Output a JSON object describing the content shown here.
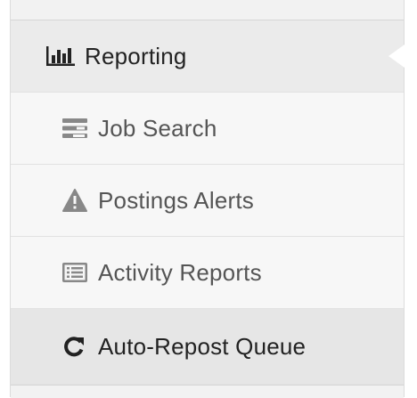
{
  "nav": {
    "parent": {
      "label": "Reporting",
      "icon": "bar-chart-icon"
    },
    "children": [
      {
        "label": "Job Search",
        "icon": "search-list-icon"
      },
      {
        "label": "Postings Alerts",
        "icon": "warning-icon"
      },
      {
        "label": "Activity Reports",
        "icon": "list-report-icon"
      },
      {
        "label": "Auto-Repost Queue",
        "icon": "refresh-icon"
      }
    ],
    "active_index": 3
  },
  "colors": {
    "parent_bg": "#ebebeb",
    "child_bg": "#f7f7f7",
    "active_bg": "#e6e6e6",
    "child_text": "#555555",
    "active_text": "#222222"
  }
}
